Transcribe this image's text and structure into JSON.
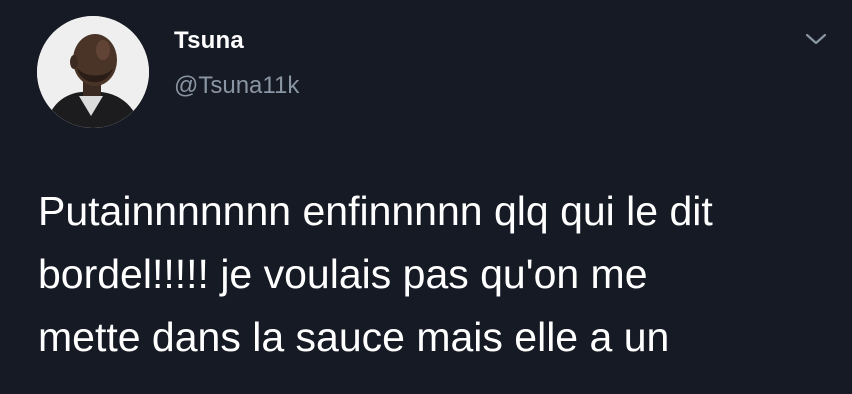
{
  "author": {
    "display_name": "Tsuna",
    "handle": "@Tsuna11k",
    "avatar_icon": "profile-photo"
  },
  "menu": {
    "icon": "chevron-down-icon"
  },
  "tweet": {
    "lines": [
      "Putainnnnnnn enfinnnnn qlq qui le dit",
      "bordel!!!!! je voulais pas qu'on me",
      "mette dans la sauce mais elle a un"
    ]
  },
  "colors": {
    "background": "#151a24",
    "text": "#ffffff",
    "secondary_text": "#8a95a3"
  }
}
